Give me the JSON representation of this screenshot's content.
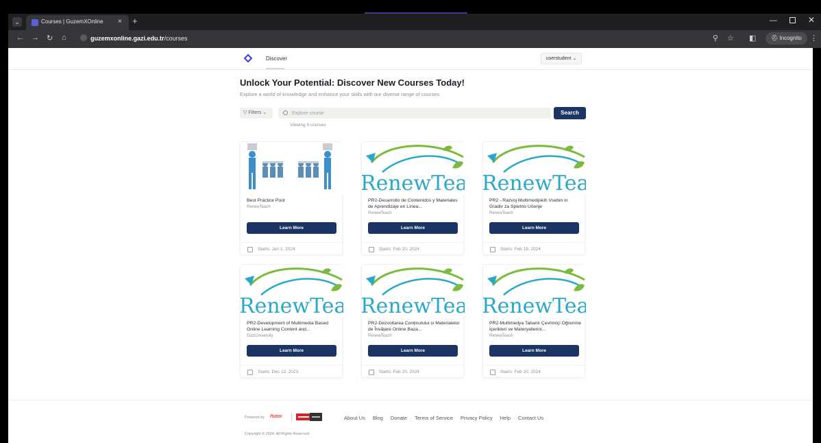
{
  "browser": {
    "tab_title": "Courses | GuzemXOnline",
    "tab_close": "×",
    "new_tab": "+",
    "url_domain": "guzemxonline.gazi.edu.tr",
    "url_path": "/courses",
    "incognito_label": "Incognito"
  },
  "header": {
    "nav_discover": "Discover",
    "user_menu": "userstudent ⌄"
  },
  "hero": {
    "title": "Unlock Your Potential: Discover New Courses Today!",
    "subtitle": "Explore a world of knowledge and enhance your skills with our diverse range of courses"
  },
  "search": {
    "filters_label": "▽ Filters ⌄",
    "placeholder": "Explore course",
    "button": "Search",
    "viewing": "Viewing 6 courses"
  },
  "courses": [
    {
      "title": "Best Practice Pool",
      "org": "RenewTeach",
      "button": "Learn More",
      "starts": "Starts: Jan 1, 2024"
    },
    {
      "title": "PR2-Desarrollo de Contenidos y Materiales de Aprendizaje en Línea...",
      "org": "RenewTeach",
      "button": "Learn More",
      "starts": "Starts: Feb 20, 2024"
    },
    {
      "title": "PR2 - Razvoj Multimedijskih Vsebin in Gradiv za Spletno Učenje",
      "org": "RenewTeach",
      "button": "Learn More",
      "starts": "Starts: Feb 18, 2024"
    },
    {
      "title": "PR2-Development of Multimedia Based Online Learning Content and...",
      "org": "GaziUniversity",
      "button": "Learn More",
      "starts": "Starts: Dec 12, 2023"
    },
    {
      "title": "PR2-Dezvoltarea Conținutului și Materialelor de Învățare Online Baza...",
      "org": "RenewTeach",
      "button": "Learn More",
      "starts": "Starts: Feb 20, 2024"
    },
    {
      "title": "PR2-Multimedya Tabanlı Çevrimiçi Öğrenme İçerikleri ve Materyallerini...",
      "org": "RenewTeach",
      "button": "Learn More",
      "starts": "Starts: Feb 20, 2024"
    }
  ],
  "logo_text": "RenewTeach",
  "footer": {
    "powered_by": "Powered by",
    "tutor_logo": "/tutor",
    "links": [
      "About Us",
      "Blog",
      "Donate",
      "Terms of Service",
      "Privacy Policy",
      "Help",
      "Contact Us"
    ],
    "copyright": "Copyright © 2024. All Rights Reserved."
  },
  "colors": {
    "primary_button": "#1c3464",
    "logo_green": "#7cba3d",
    "logo_teal": "#2aa8c9"
  }
}
